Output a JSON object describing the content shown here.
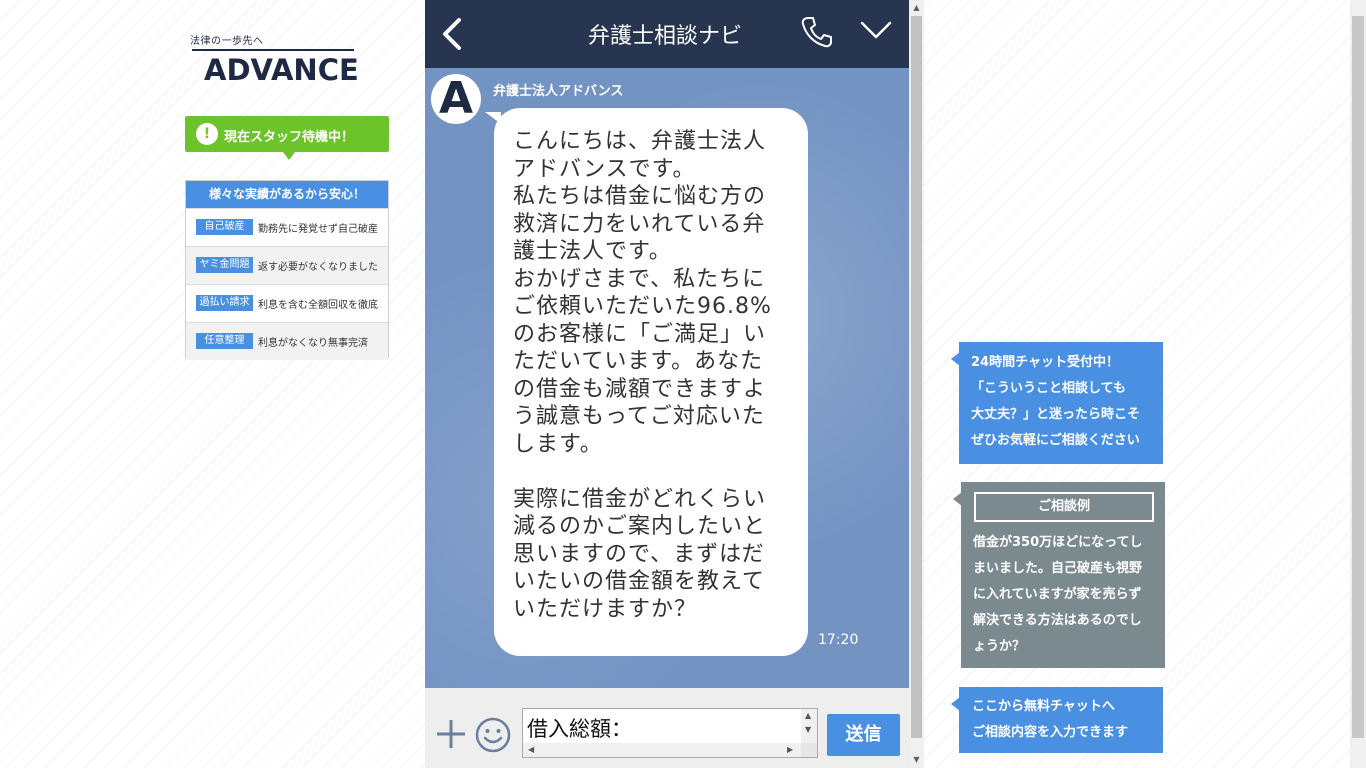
{
  "logo": {
    "tagline": "法律の一歩先へ",
    "brand": "ADVANCE"
  },
  "staff_status": {
    "icon": "exclamation-icon",
    "text": "現在スタッフ待機中！"
  },
  "records": {
    "heading": "様々な実績があるから安心！",
    "items": [
      {
        "tag": "自己破産",
        "desc": "勤務先に発覚せず自己破産"
      },
      {
        "tag": "ヤミ金問題",
        "desc": "返す必要がなくなりました"
      },
      {
        "tag": "過払い請求",
        "desc": "利息を含む全額回収を徹底"
      },
      {
        "tag": "任意整理",
        "desc": "利息がなくなり無事完済"
      }
    ]
  },
  "chat": {
    "header": {
      "back_icon": "back-chevron-icon",
      "title": "弁護士相談ナビ",
      "phone_icon": "phone-icon",
      "collapse_icon": "chevron-down-icon"
    },
    "avatar_letter": "A",
    "sender": "弁護士法人アドバンス",
    "message": "こんにちは、弁護士法人\nアドバンスです。\n私たちは借金に悩む方の\n救済に力をいれている弁\n護士法人です。\nおかげさまで、私たちに\nご依頼いただいた96.8%\nのお客様に「ご満足」い\nただいています。あなた\nの借金も減額できますよ\nう誠意もってご対応いた\nします。\n\n実際に借金がどれくらい\n減るのかご案内したいと\n思いますので、まずはだ\nいたいの借金額を教えて\nいただけますか？",
    "time": "17:20",
    "input_value": "借入総額：",
    "send_label": "送信"
  },
  "info_boxes": {
    "box1": {
      "lines": [
        "24時間チャット受付中！",
        "「こういうこと相談しても",
        "大丈夫？」と迷ったら時こそ",
        "ぜひお気軽にご相談ください"
      ]
    },
    "box2": {
      "title": "ご相談例",
      "lines": [
        "借金が350万ほどになってし",
        "まいました。自己破産も視野",
        "に入れていますが家を売らず",
        "解決できる方法はあるのでし",
        "ょうか？"
      ]
    },
    "box3": {
      "lines": [
        "ここから無料チャットへ",
        "ご相談内容を入力できます"
      ]
    }
  },
  "colors": {
    "brand_navy": "#1e2a44",
    "header_navy": "#273550",
    "chat_bg": "#7393c3",
    "accent_blue": "#4a90e2",
    "status_green": "#6cc42a",
    "info_gray": "#7a8a8f"
  }
}
